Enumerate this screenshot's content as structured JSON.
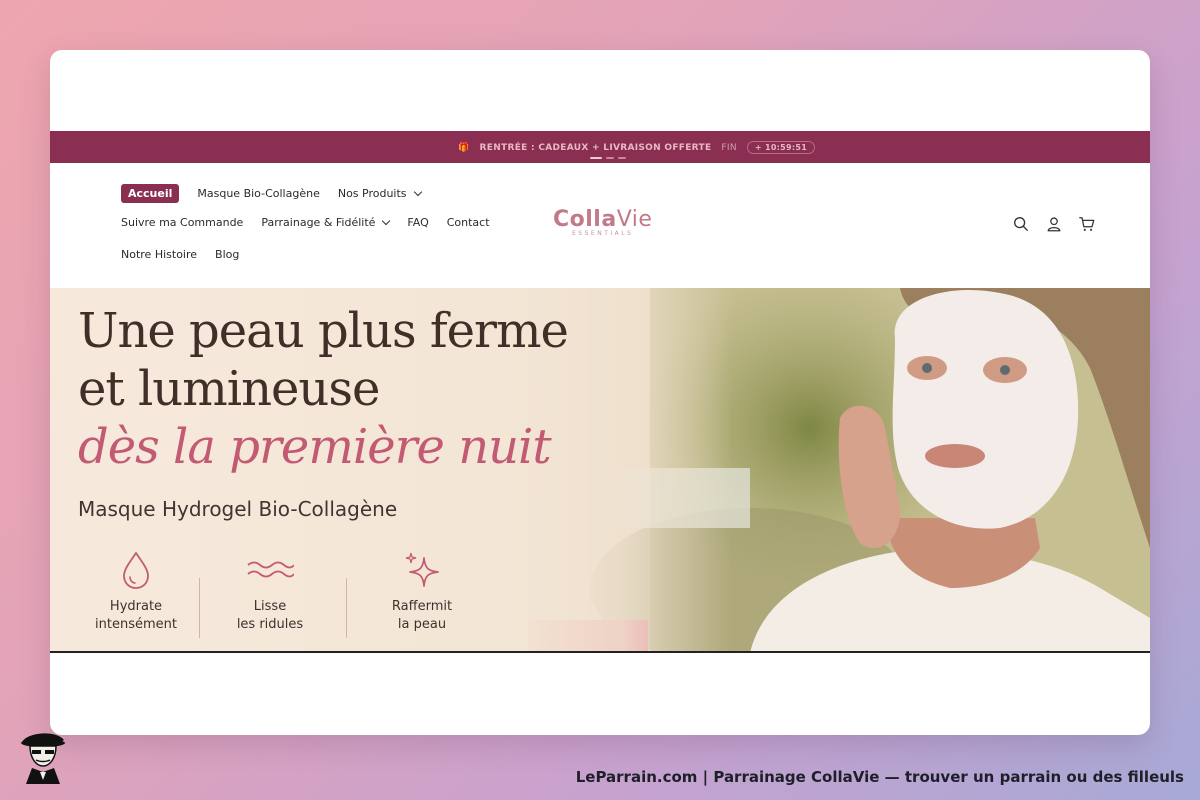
{
  "announcement": {
    "text": "RENTRÉE : CADEAUX + LIVRAISON OFFERTE",
    "end_label": "FIN",
    "timer": "10:59:51"
  },
  "nav": {
    "row1": [
      {
        "label": "Accueil",
        "active": true
      },
      {
        "label": "Masque Bio-Collagène"
      },
      {
        "label": "Nos Produits",
        "dropdown": true
      }
    ],
    "row2": [
      {
        "label": "Suivre ma Commande"
      },
      {
        "label": "Parrainage & Fidélité",
        "dropdown": true
      },
      {
        "label": "FAQ"
      },
      {
        "label": "Contact"
      }
    ],
    "row3": [
      {
        "label": "Notre Histoire"
      },
      {
        "label": "Blog"
      }
    ]
  },
  "logo": {
    "brand_bold": "Colla",
    "brand_rest": "Vie",
    "tagline": "ESSENTIALS"
  },
  "header_icons": [
    "search-icon",
    "account-icon",
    "cart-icon"
  ],
  "hero": {
    "line1": "Une peau plus ferme",
    "line2": "et lumineuse",
    "line3": "dès la première nuit",
    "subtitle": "Masque Hydrogel Bio-Collagène",
    "features": [
      {
        "icon": "droplet-icon",
        "line1": "Hydrate",
        "line2": "intensément"
      },
      {
        "icon": "waves-icon",
        "line1": "Lisse",
        "line2": "les ridules"
      },
      {
        "icon": "sparkle-icon",
        "line1": "Raffermit",
        "line2": "la peau"
      }
    ]
  },
  "caption": "LeParrain.com | Parrainage CollaVie — trouver un parrain ou des filleuls",
  "colors": {
    "brand": "#8a2f51",
    "accent": "#c35a74",
    "logo": "#c27a88"
  }
}
